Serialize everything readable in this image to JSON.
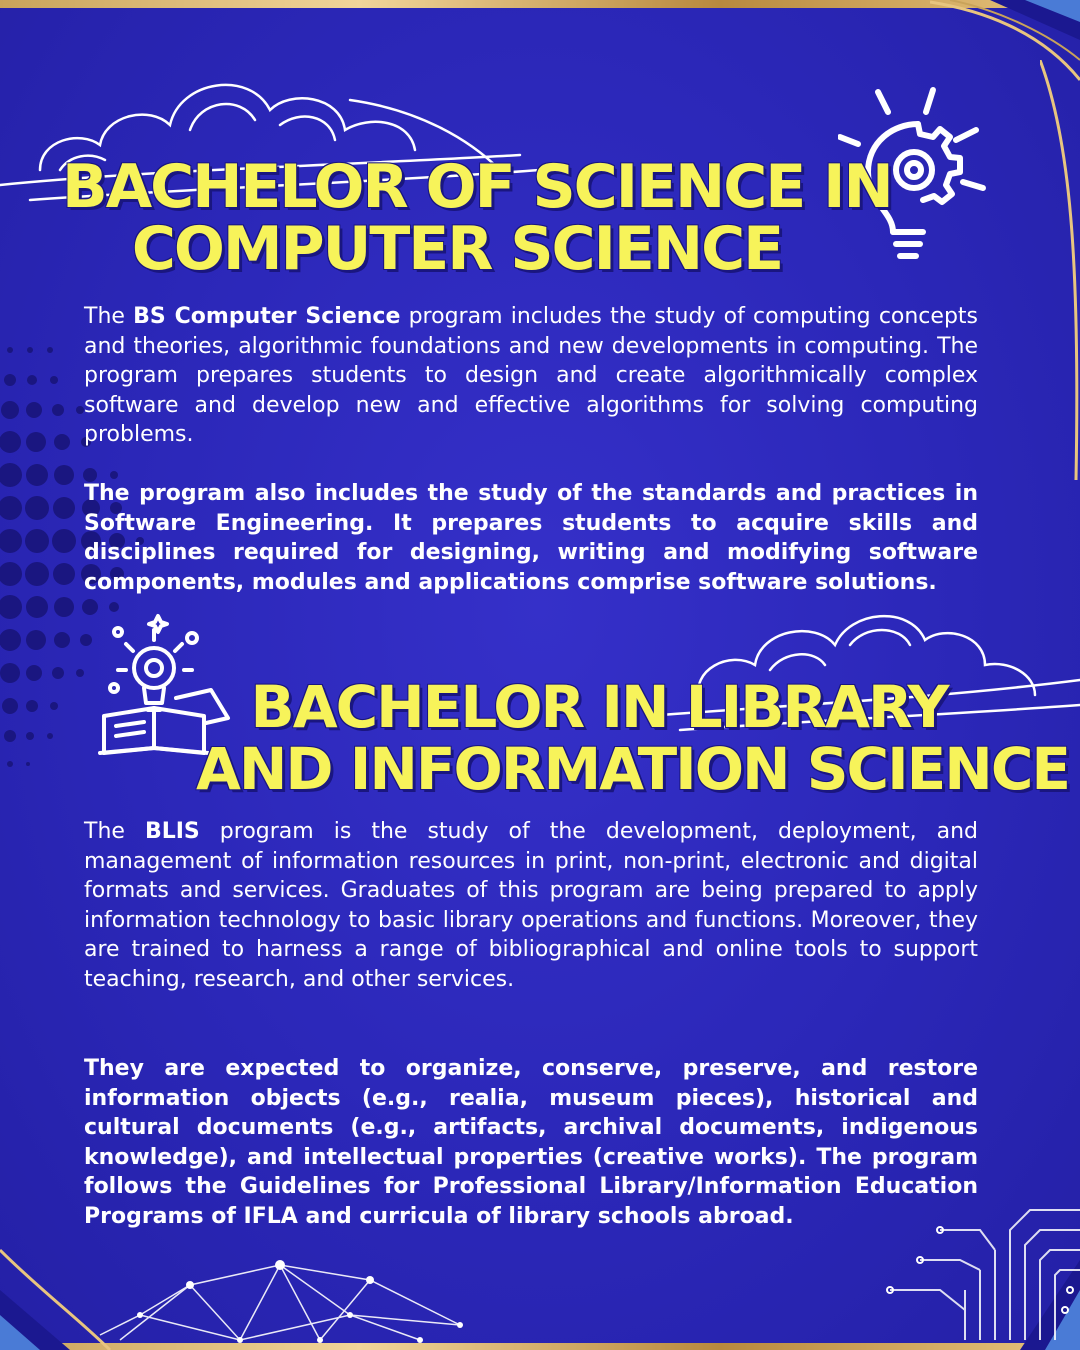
{
  "colors": {
    "background": "#2b27b8",
    "heading": "#f7f35a",
    "text": "#ffffff",
    "gold": "#e8c57f"
  },
  "section1": {
    "title_line1": "BACHELOR OF SCIENCE IN",
    "title_line2": "COMPUTER SCIENCE",
    "icon": "lightbulb-gear-icon",
    "p1_prefix": "The ",
    "p1_bold": "BS Computer Science",
    "p1_rest": " program includes the study of computing concepts and theories, algorithmic foundations and new developments in computing. The program prepares students to design and create algorithmically complex software and develop new and effective algorithms for solving computing problems.",
    "p2": "The program also includes the study of the standards and practices in Software Engineering. It prepares students to acquire skills and disciplines required for designing, writing and modifying software components, modules and applications comprise software solutions."
  },
  "section2": {
    "title_line1": "BACHELOR IN LIBRARY",
    "title_line2": "AND INFORMATION SCIENCE",
    "icon": "book-lightbulb-icon",
    "p1_prefix": "The ",
    "p1_bold": "BLIS",
    "p1_rest": " program is the study of the development, deployment, and management of information resources in print, non-print, electronic and digital formats and services. Graduates of this program are being prepared to apply information technology to basic library operations and functions. Moreover, they are trained to harness a range of bibliographical and online tools to support teaching, research, and other services.",
    "p2": "They are expected to organize, conserve, preserve, and restore information objects (e.g., realia, museum pieces), historical and cultural documents (e.g., artifacts, archival documents, indigenous knowledge), and intellectual properties (creative works). The program follows the Guidelines for Professional Library/Information Education Programs of IFLA and curricula of library schools abroad."
  }
}
